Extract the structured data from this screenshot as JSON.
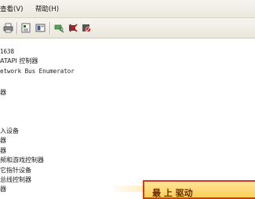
{
  "menu": {
    "items": [
      {
        "label": "查看(V)"
      },
      {
        "label": "帮助(H)"
      }
    ]
  },
  "toolbar": {
    "buttons": [
      {
        "icon": "print-icon"
      },
      {
        "icon": "properties-icon"
      },
      {
        "icon": "view-icon"
      },
      {
        "icon": "scan-hardware-icon"
      },
      {
        "icon": "uninstall-icon"
      },
      {
        "icon": "disable-icon"
      }
    ]
  },
  "tree": {
    "rows": [
      {
        "text": "1638"
      },
      {
        "text": "ATAPI 控制器"
      },
      {
        "text": "etwork Bus Enumerator"
      },
      {
        "text": ""
      },
      {
        "text": "器"
      },
      {
        "text": ""
      },
      {
        "text": ""
      },
      {
        "text": ""
      },
      {
        "text": "入设备"
      },
      {
        "text": "器"
      },
      {
        "text": "器"
      },
      {
        "text": "频和游戏控制器"
      },
      {
        "text": "它指针设备"
      },
      {
        "text": "总线控制器"
      },
      {
        "text": "器"
      }
    ]
  },
  "popup": {
    "text": "最 上 驱动"
  }
}
